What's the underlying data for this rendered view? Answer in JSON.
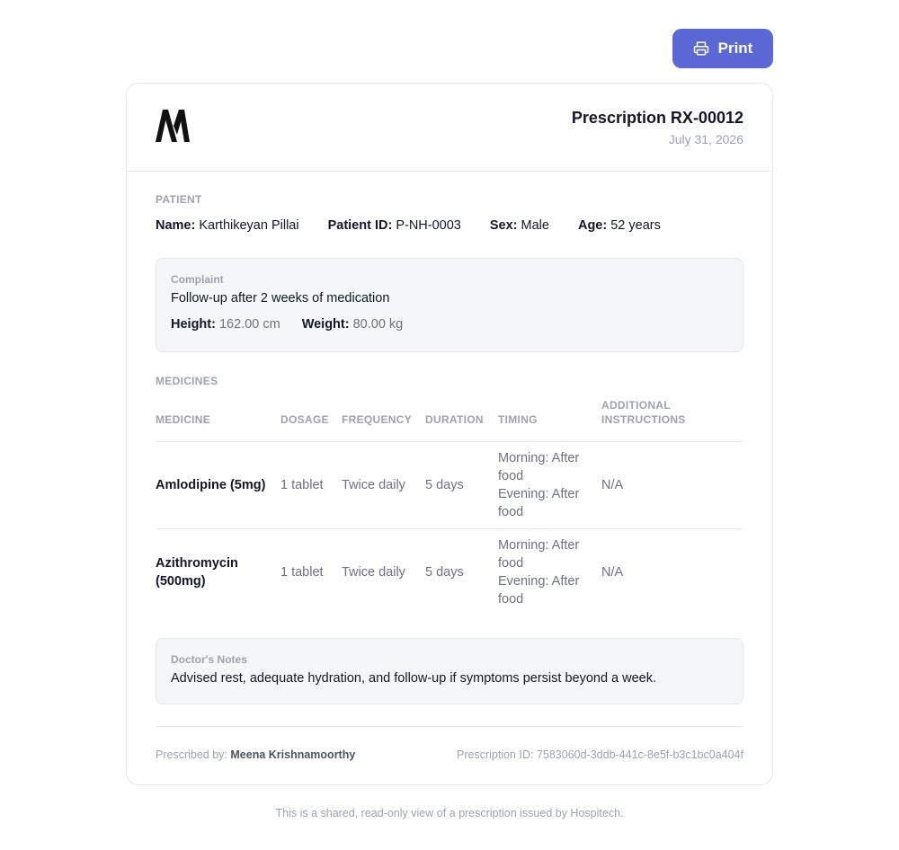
{
  "toolbar": {
    "print_label": "Print"
  },
  "header": {
    "logo_text": "M",
    "title": "Prescription RX-00012",
    "date": "July 31, 2026"
  },
  "patient": {
    "section_label": "PATIENT",
    "name_key": "Name:",
    "name": "Karthikeyan Pillai",
    "id_key": "Patient ID:",
    "id": "P-NH-0003",
    "sex_key": "Sex:",
    "sex": "Male",
    "age_key": "Age:",
    "age": "52 years"
  },
  "complaint": {
    "label": "Complaint",
    "text": "Follow-up after 2 weeks of medication",
    "height_key": "Height:",
    "height": "162.00 cm",
    "weight_key": "Weight:",
    "weight": "80.00 kg"
  },
  "medicines": {
    "section_label": "MEDICINES",
    "columns": [
      "MEDICINE",
      "DOSAGE",
      "FREQUENCY",
      "DURATION",
      "TIMING",
      "ADDITIONAL INSTRUCTIONS"
    ],
    "rows": [
      {
        "medicine": "Amlodipine (5mg)",
        "dosage": "1 tablet",
        "frequency": "Twice daily",
        "duration": "5 days",
        "timing": [
          "Morning: After food",
          "Evening: After food"
        ],
        "instructions": "N/A"
      },
      {
        "medicine": "Azithromycin (500mg)",
        "dosage": "1 tablet",
        "frequency": "Twice daily",
        "duration": "5 days",
        "timing": [
          "Morning: After food",
          "Evening: After food"
        ],
        "instructions": "N/A"
      }
    ]
  },
  "notes": {
    "label": "Doctor's Notes",
    "text": "Advised rest, adequate hydration, and follow-up if symptoms persist beyond a week."
  },
  "footer": {
    "prescribed_by_label": "Prescribed by:",
    "doctor": "Meena Krishnamoorthy",
    "prescription_id_label": "Prescription ID:",
    "prescription_id": "7583060d-3ddb-441c-8e5f-b3c1bc0a404f"
  },
  "disclaimer": "This is a shared, read-only view of a prescription issued by Hospitech.",
  "colors": {
    "accent": "#5c67d6",
    "muted": "#9ca3af",
    "panel": "#f5f6f8"
  }
}
